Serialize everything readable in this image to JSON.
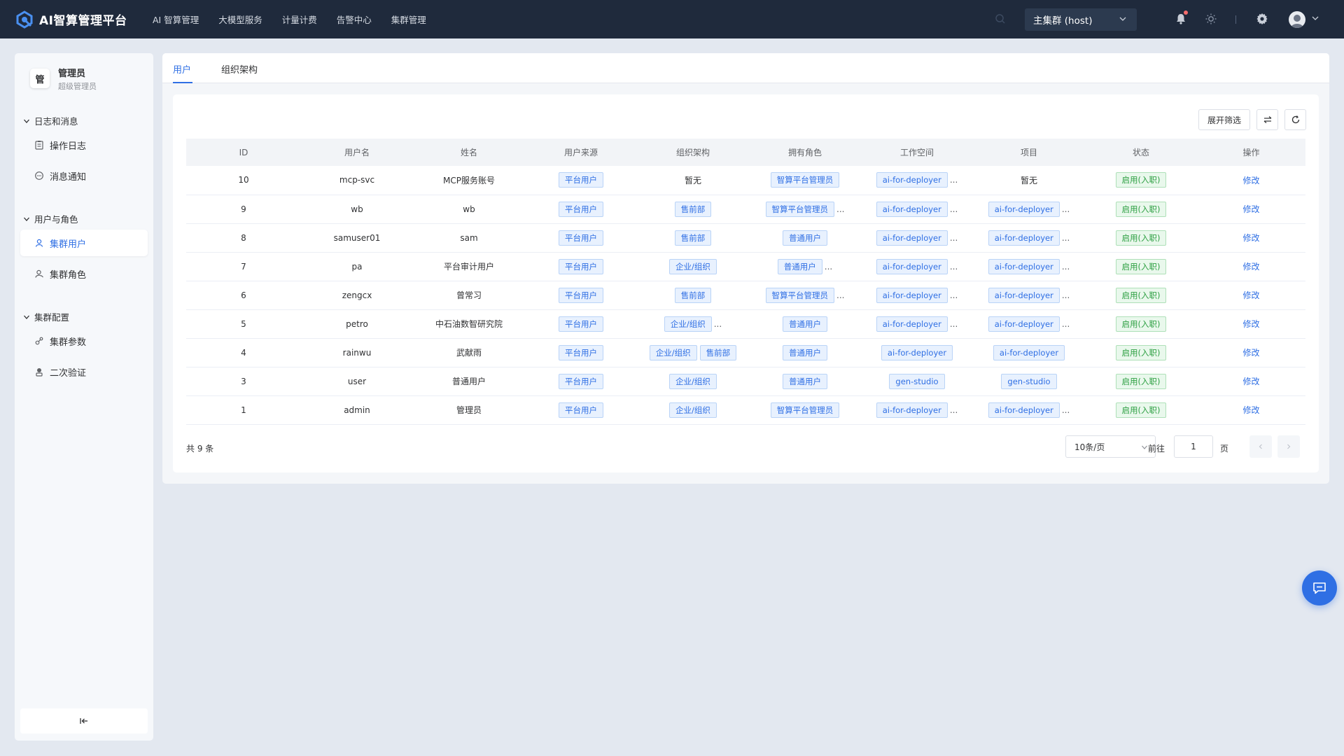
{
  "app": {
    "title": "AI智算管理平台"
  },
  "nav": [
    "AI 智算管理",
    "大模型服务",
    "计量计费",
    "告警中心",
    "集群管理"
  ],
  "cluster_select": {
    "value": "主集群 (host)"
  },
  "sidebar": {
    "user": {
      "badge": "管",
      "name": "管理员",
      "role": "超级管理员"
    },
    "groups": [
      {
        "title": "日志和消息",
        "items": [
          {
            "label": "操作日志",
            "icon": "clipboard-icon"
          },
          {
            "label": "消息通知",
            "icon": "message-icon"
          }
        ]
      },
      {
        "title": "用户与角色",
        "items": [
          {
            "label": "集群用户",
            "icon": "user-icon",
            "active": true
          },
          {
            "label": "集群角色",
            "icon": "user-role-icon"
          }
        ]
      },
      {
        "title": "集群配置",
        "items": [
          {
            "label": "集群参数",
            "icon": "params-icon"
          },
          {
            "label": "二次验证",
            "icon": "verify-icon"
          }
        ]
      }
    ]
  },
  "tabs": [
    "用户",
    "组织架构"
  ],
  "toolbar": {
    "filter_label": "展开筛选"
  },
  "table": {
    "columns": [
      "ID",
      "用户名",
      "姓名",
      "用户来源",
      "组织架构",
      "拥有角色",
      "工作空间",
      "项目",
      "状态",
      "操作"
    ],
    "rows": [
      {
        "id": "10",
        "username": "mcp-svc",
        "name": "MCP服务账号",
        "source": "平台用户",
        "org": [],
        "org_text": "暂无",
        "org_more": false,
        "roles": [
          "智算平台管理员"
        ],
        "roles_more": false,
        "workspace": [
          "ai-for-deployer"
        ],
        "workspace_more": true,
        "project": [],
        "project_text": "暂无",
        "project_more": false,
        "status": "启用(入职)",
        "action": "修改"
      },
      {
        "id": "9",
        "username": "wb",
        "name": "wb",
        "source": "平台用户",
        "org": [
          "售前部"
        ],
        "org_more": false,
        "roles": [
          "智算平台管理员"
        ],
        "roles_more": true,
        "workspace": [
          "ai-for-deployer"
        ],
        "workspace_more": true,
        "project": [
          "ai-for-deployer"
        ],
        "project_more": true,
        "status": "启用(入职)",
        "action": "修改"
      },
      {
        "id": "8",
        "username": "samuser01",
        "name": "sam",
        "source": "平台用户",
        "org": [
          "售前部"
        ],
        "org_more": false,
        "roles": [
          "普通用户"
        ],
        "roles_more": false,
        "workspace": [
          "ai-for-deployer"
        ],
        "workspace_more": true,
        "project": [
          "ai-for-deployer"
        ],
        "project_more": true,
        "status": "启用(入职)",
        "action": "修改"
      },
      {
        "id": "7",
        "username": "pa",
        "name": "平台审计用户",
        "source": "平台用户",
        "org": [
          "企业/组织"
        ],
        "org_more": false,
        "roles": [
          "普通用户"
        ],
        "roles_more": true,
        "workspace": [
          "ai-for-deployer"
        ],
        "workspace_more": true,
        "project": [
          "ai-for-deployer"
        ],
        "project_more": true,
        "status": "启用(入职)",
        "action": "修改"
      },
      {
        "id": "6",
        "username": "zengcx",
        "name": "曾常习",
        "source": "平台用户",
        "org": [
          "售前部"
        ],
        "org_more": false,
        "roles": [
          "智算平台管理员"
        ],
        "roles_more": true,
        "workspace": [
          "ai-for-deployer"
        ],
        "workspace_more": true,
        "project": [
          "ai-for-deployer"
        ],
        "project_more": true,
        "status": "启用(入职)",
        "action": "修改"
      },
      {
        "id": "5",
        "username": "petro",
        "name": "中石油数智研究院",
        "source": "平台用户",
        "org": [
          "企业/组织"
        ],
        "org_more": true,
        "roles": [
          "普通用户"
        ],
        "roles_more": false,
        "workspace": [
          "ai-for-deployer"
        ],
        "workspace_more": true,
        "project": [
          "ai-for-deployer"
        ],
        "project_more": true,
        "status": "启用(入职)",
        "action": "修改"
      },
      {
        "id": "4",
        "username": "rainwu",
        "name": "武献雨",
        "source": "平台用户",
        "org": [
          "企业/组织",
          "售前部"
        ],
        "org_more": false,
        "roles": [
          "普通用户"
        ],
        "roles_more": false,
        "workspace": [
          "ai-for-deployer"
        ],
        "workspace_more": false,
        "project": [
          "ai-for-deployer"
        ],
        "project_more": false,
        "status": "启用(入职)",
        "action": "修改"
      },
      {
        "id": "3",
        "username": "user",
        "name": "普通用户",
        "source": "平台用户",
        "org": [
          "企业/组织"
        ],
        "org_more": false,
        "roles": [
          "普通用户"
        ],
        "roles_more": false,
        "workspace": [
          "gen-studio"
        ],
        "workspace_more": false,
        "project": [
          "gen-studio"
        ],
        "project_more": false,
        "status": "启用(入职)",
        "action": "修改"
      },
      {
        "id": "1",
        "username": "admin",
        "name": "管理员",
        "source": "平台用户",
        "org": [
          "企业/组织"
        ],
        "org_more": false,
        "roles": [
          "智算平台管理员"
        ],
        "roles_more": false,
        "workspace": [
          "ai-for-deployer"
        ],
        "workspace_more": true,
        "project": [
          "ai-for-deployer"
        ],
        "project_more": true,
        "status": "启用(入职)",
        "action": "修改"
      }
    ],
    "more_glyph": "..."
  },
  "pagination": {
    "total": "共 9 条",
    "page_size": "10条/页",
    "goto_prefix": "前往",
    "goto_value": "1",
    "goto_suffix": "页"
  },
  "colors": {
    "topbar": "#1f2a3c",
    "accent": "#2f6fe4",
    "status_green": "#2ea043",
    "page_bg": "#e3e8f0"
  }
}
